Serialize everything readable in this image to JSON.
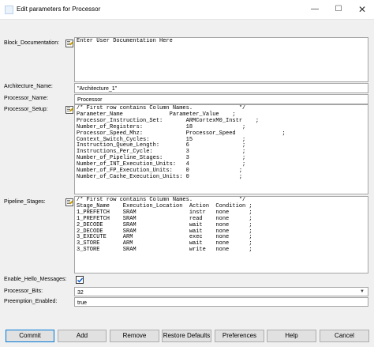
{
  "window": {
    "title": "Edit parameters for Processor"
  },
  "fields": {
    "block_documentation": {
      "label": "Block_Documentation:",
      "value": "Enter User Documentation Here"
    },
    "architecture_name": {
      "label": "Architecture_Name:",
      "value": "\"Architecture_1\""
    },
    "processor_name": {
      "label": "Processor_Name:",
      "value": "Processor"
    },
    "processor_setup": {
      "label": "Processor_Setup:",
      "value": "/* First row contains Column Names.              */\nParameter_Name              Parameter_Value    ;\nProcessor_Instruction_Set:       ARMCortexM0_Instr    ;\nNumber_of_Registers:             18               ;\nProcessor_Speed_Mhz:             Processor_Speed              ;\nContext_Switch_Cycles:           15               ;\nInstruction_Queue_Length:        6                ;\nInstructions_Per_Cycle:          3                ;\nNumber_of_Pipeline_Stages:       3                ;\nNumber_of_INT_Execution_Units:   4                ;\nNumber_of_FP_Execution_Units:    0               ;\nNumber_of_Cache_Execution_Units: 0               ;"
    },
    "pipeline_stages": {
      "label": "Pipeline_Stages:",
      "value": "/* First row contains Column Names.              */\nStage_Name    Execution_Location  Action  Condition ;\n1_PREFETCH    SRAM                instr   none      ;\n1_PREFETCH    SRAM                read    none      ;\n2_DECODE      SRAM                wait    none      ;\n2_DECODE      SRAM                wait    none      ;\n3_EXECUTE     ARM                 exec    none      ;\n3_STORE       ARM                 wait    none      ;\n3_STORE       SRAM                write   none      ;"
    },
    "enable_hello_messages": {
      "label": "Enable_Hello_Messages:",
      "checked": true
    },
    "processor_bits": {
      "label": "Processor_Bits:",
      "value": "32"
    },
    "preemption_enabled": {
      "label": "Preemption_Enabled:",
      "value": "true"
    }
  },
  "buttons": {
    "commit": "Commit",
    "add": "Add",
    "remove": "Remove",
    "restore_defaults": "Restore Defaults",
    "preferences": "Preferences",
    "help": "Help",
    "cancel": "Cancel"
  },
  "icons": {
    "minimize": "minimize-icon",
    "maximize": "maximize-icon",
    "close": "close-icon",
    "edit": "edit-documentation-icon"
  }
}
